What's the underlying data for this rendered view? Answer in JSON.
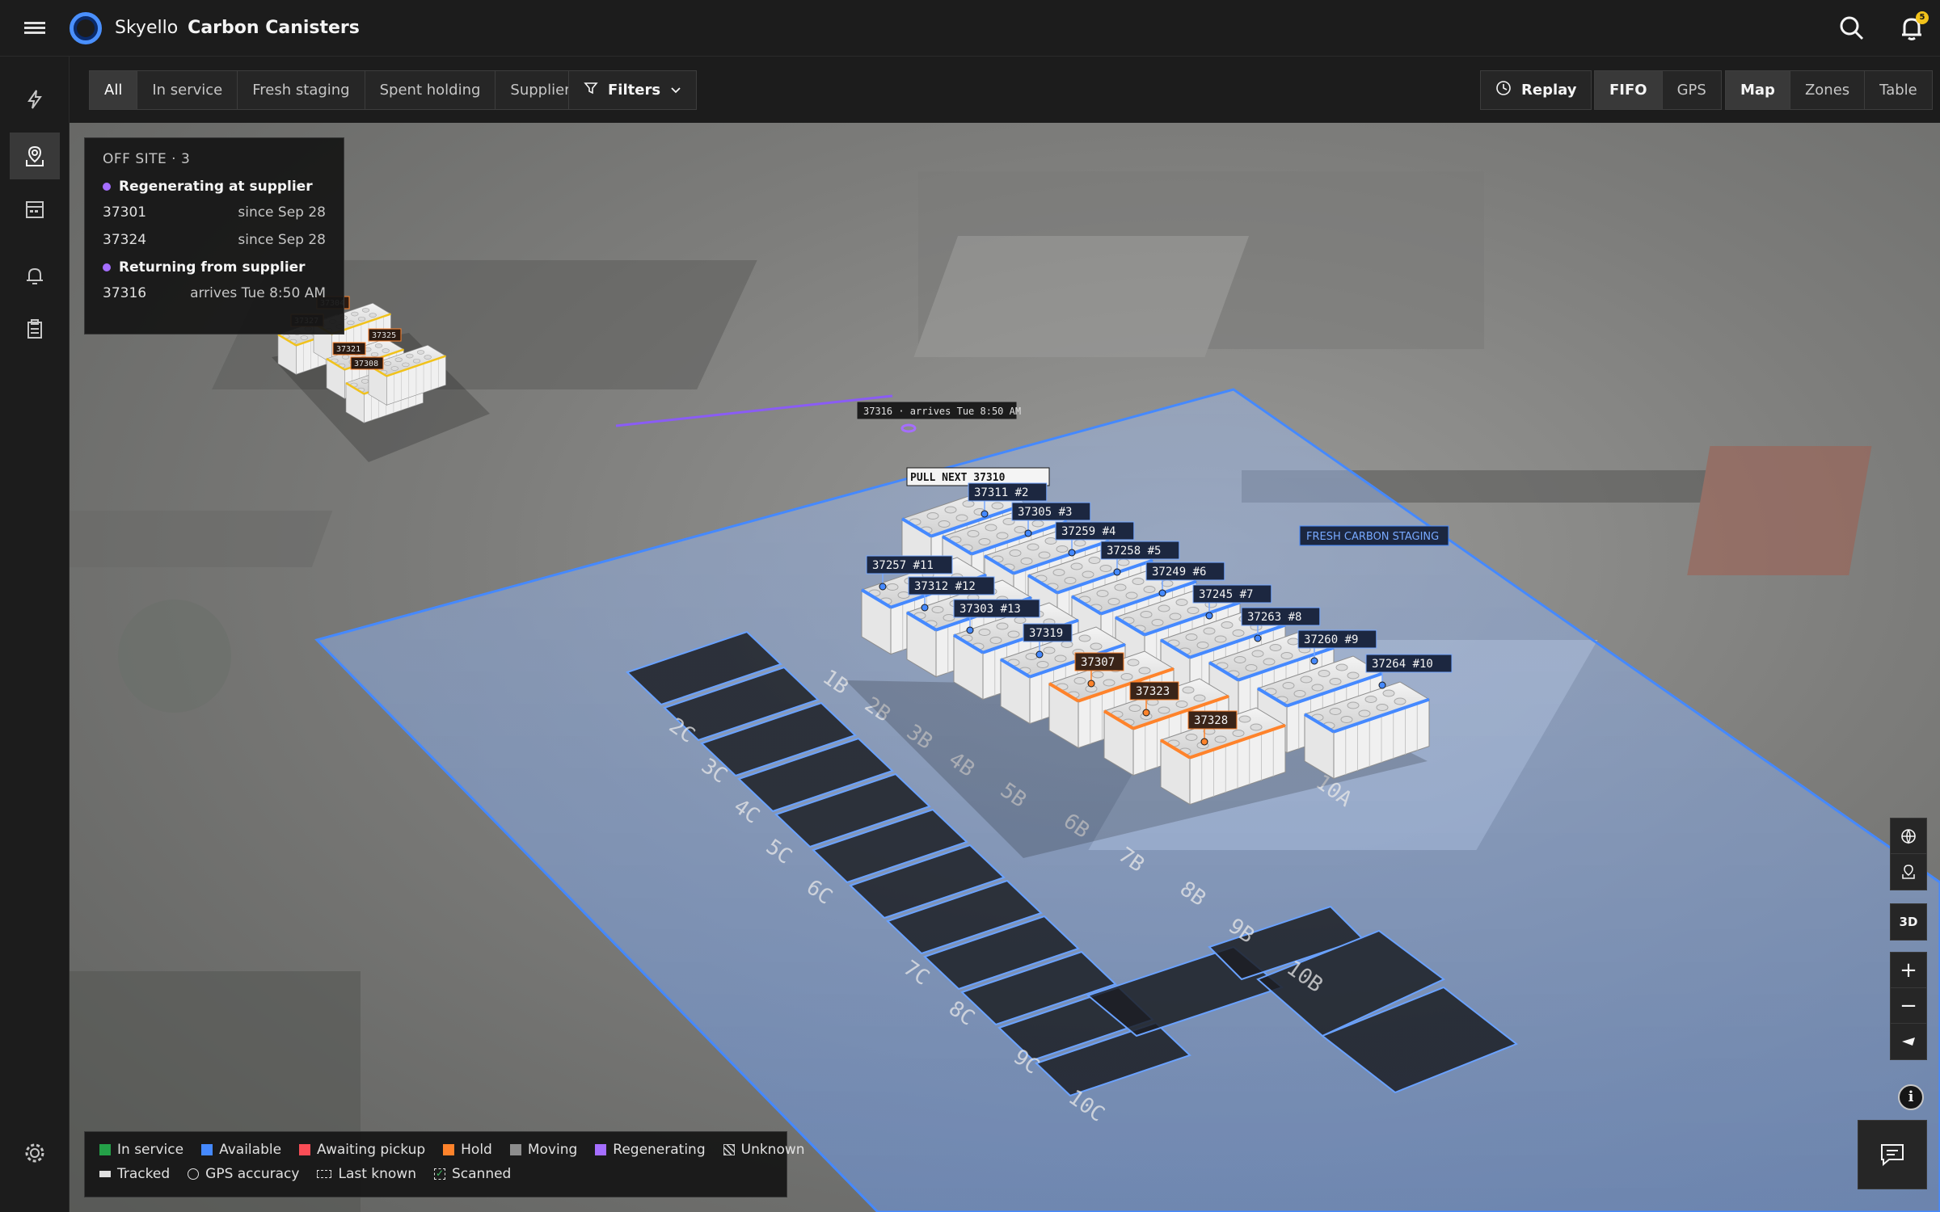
{
  "header": {
    "brand": "Skyello",
    "app_title": "Carbon Canisters",
    "notifications_count": "5"
  },
  "filters": {
    "tabs": [
      "All",
      "In service",
      "Fresh staging",
      "Spent holding",
      "Supplier"
    ],
    "active_tab": "All",
    "filters_label": "Filters"
  },
  "view_controls": {
    "replay_label": "Replay",
    "order_modes": [
      "FIFO",
      "GPS"
    ],
    "active_order": "FIFO",
    "views": [
      "Map",
      "Zones",
      "Table"
    ],
    "active_view": "Map"
  },
  "offsite": {
    "title": "OFF SITE · 3",
    "groups": [
      {
        "label": "Regenerating at supplier",
        "items": [
          {
            "id": "37301",
            "status": "since Sep 28"
          },
          {
            "id": "37324",
            "status": "since Sep 28"
          }
        ]
      },
      {
        "label": "Returning from supplier",
        "items": [
          {
            "id": "37316",
            "status": "arrives Tue 8:50 AM"
          }
        ]
      }
    ]
  },
  "map": {
    "zone_label": "FRESH CARBON STAGING",
    "pull_next_label": "PULL NEXT  37310",
    "transit_label": "37316 · arrives Tue 8:50 AM",
    "supplier_tags": [
      "37304",
      "37327",
      "37325",
      "37321",
      "37308"
    ],
    "queue_tags": [
      "37311  #2",
      "37305  #3",
      "37259  #4",
      "37258  #5",
      "37249  #6",
      "37245  #7",
      "37263  #8",
      "37260  #9",
      "37264  #10",
      "37257  #11",
      "37312  #12",
      "37303  #13",
      "37319"
    ],
    "hold_tags": [
      "37307",
      "37323",
      "37328"
    ],
    "bay_labels": [
      "1B",
      "2B",
      "3B",
      "4B",
      "5B",
      "6B",
      "7B",
      "8B",
      "9B",
      "10B",
      "10A",
      "2C",
      "3C",
      "4C",
      "5C",
      "6C",
      "7C",
      "8C",
      "9C",
      "10C"
    ],
    "mode_3d": "3D"
  },
  "legend": {
    "statuses": [
      {
        "label": "In service",
        "color": "#24a148"
      },
      {
        "label": "Available",
        "color": "#4589ff"
      },
      {
        "label": "Awaiting pickup",
        "color": "#fa4d56"
      },
      {
        "label": "Hold",
        "color": "#ff832b"
      },
      {
        "label": "Moving",
        "color": "#8d8d8d"
      },
      {
        "label": "Regenerating",
        "color": "#a56eff"
      },
      {
        "label": "Unknown",
        "color": "#6f6f6f"
      }
    ],
    "markers": [
      "Tracked",
      "GPS accuracy",
      "Last known",
      "Scanned"
    ]
  },
  "colors": {
    "accent": "#4589ff",
    "hold": "#ff832b",
    "regenerating": "#a56eff",
    "zone_fill": "#78a9ff"
  }
}
